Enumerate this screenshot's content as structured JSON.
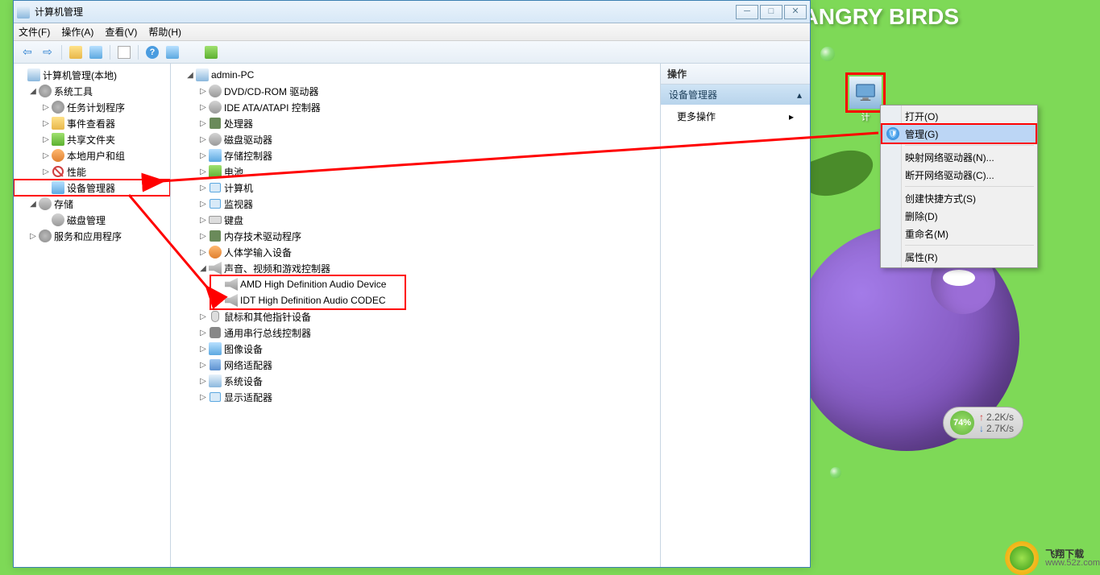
{
  "window": {
    "title": "计算机管理",
    "menus": [
      "文件(F)",
      "操作(A)",
      "查看(V)",
      "帮助(H)"
    ]
  },
  "left_tree": {
    "root": "计算机管理(本地)",
    "system_tools": {
      "label": "系统工具",
      "items": [
        "任务计划程序",
        "事件查看器",
        "共享文件夹",
        "本地用户和组",
        "性能",
        "设备管理器"
      ]
    },
    "storage": {
      "label": "存储",
      "items": [
        "磁盘管理"
      ]
    },
    "services": {
      "label": "服务和应用程序"
    }
  },
  "center_tree": {
    "root": "admin-PC",
    "items": [
      "DVD/CD-ROM 驱动器",
      "IDE ATA/ATAPI 控制器",
      "处理器",
      "磁盘驱动器",
      "存储控制器",
      "电池",
      "计算机",
      "监视器",
      "键盘",
      "内存技术驱动程序",
      "人体学输入设备"
    ],
    "sound": {
      "label": "声音、视频和游戏控制器",
      "children": [
        "AMD High Definition Audio Device",
        "IDT High Definition Audio CODEC"
      ]
    },
    "items_after": [
      "鼠标和其他指针设备",
      "通用串行总线控制器",
      "图像设备",
      "网络适配器",
      "系统设备",
      "显示适配器"
    ]
  },
  "right_pane": {
    "header": "操作",
    "section": "设备管理器",
    "more": "更多操作"
  },
  "context_menu": {
    "items": [
      "打开(O)",
      "管理(G)",
      "映射网络驱动器(N)...",
      "断开网络驱动器(C)...",
      "创建快捷方式(S)",
      "删除(D)",
      "重命名(M)",
      "属性(R)"
    ],
    "highlighted_index": 1
  },
  "desktop": {
    "logo_text": "ANGRY BIRDS",
    "icon_label": "计"
  },
  "gadget": {
    "pct": "74%",
    "up": "2.2K/s",
    "down": "2.7K/s"
  },
  "watermark": {
    "name": "飞翔下载",
    "url": "www.52z.com"
  }
}
